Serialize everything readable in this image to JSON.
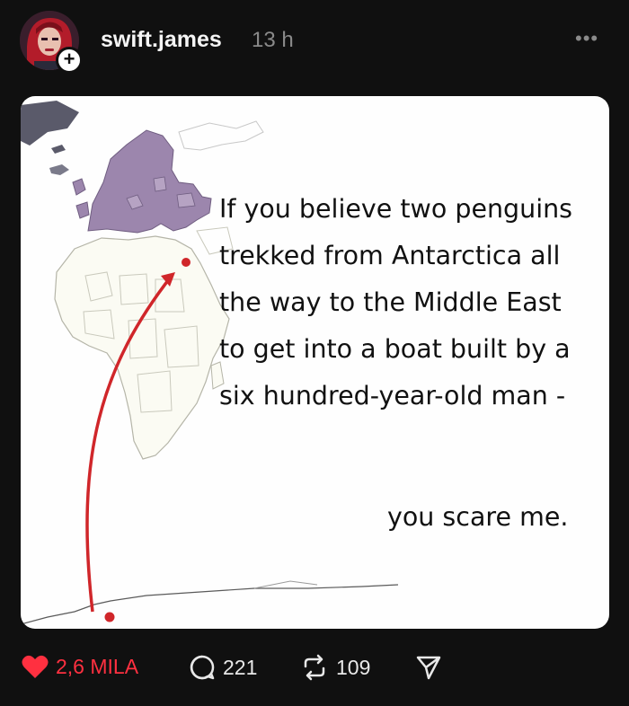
{
  "post": {
    "username": "swift.james",
    "timestamp": "13 h",
    "caption_lines": [
      "If you believe two penguins",
      "trekked from Antarctica all",
      "the way to the Middle East",
      "to get into a boat built by a",
      "six hundred-year-old man -"
    ],
    "punchline": "you scare me."
  },
  "actions": {
    "likes": "2,6 MILA",
    "comments": "221",
    "reposts": "109"
  },
  "colors": {
    "background": "#101010",
    "like_red": "#ff3040",
    "map_europe": "#9c86ad",
    "arrow_red": "#d0262a"
  },
  "icons": [
    "avatar",
    "plus-icon",
    "more-icon",
    "heart-icon",
    "comment-icon",
    "repost-icon",
    "share-icon"
  ]
}
